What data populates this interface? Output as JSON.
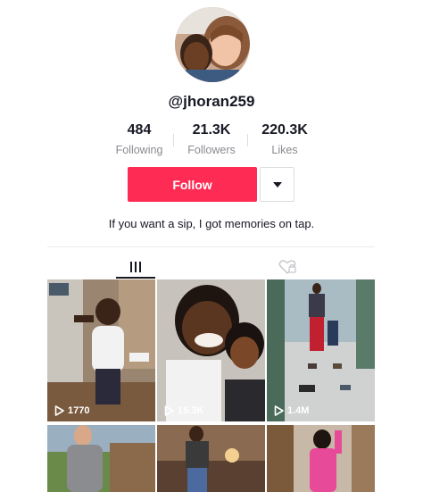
{
  "profile": {
    "username": "@jhoran259",
    "bio": "If you want a sip, I got memories on tap."
  },
  "stats": {
    "following": {
      "value": "484",
      "label": "Following"
    },
    "followers": {
      "value": "21.3K",
      "label": "Followers"
    },
    "likes": {
      "value": "220.3K",
      "label": "Likes"
    }
  },
  "actions": {
    "follow_label": "Follow"
  },
  "tabs": [
    {
      "icon": "grid-icon",
      "active": true
    },
    {
      "icon": "liked-heart-icon",
      "active": false
    }
  ],
  "videos": [
    {
      "views": "1770"
    },
    {
      "views": "15.3K"
    },
    {
      "views": "1.4M"
    },
    {
      "views": ""
    },
    {
      "views": ""
    },
    {
      "views": ""
    }
  ],
  "colors": {
    "accent": "#fe2c55",
    "text": "#161823",
    "muted": "#8a8b91"
  }
}
